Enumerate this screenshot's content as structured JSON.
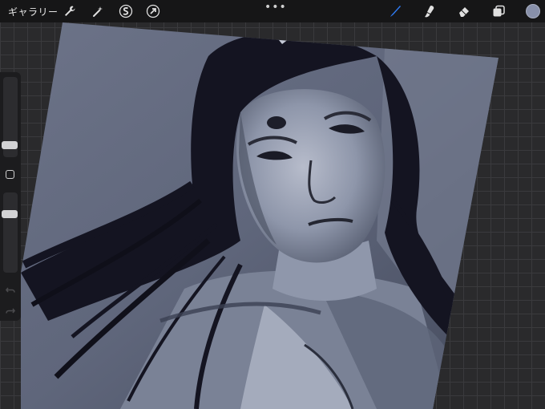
{
  "toolbar": {
    "gallery_label": "ギャラリー",
    "left_tools": [
      "wrench-icon",
      "magic-wand-icon",
      "selection-s-icon",
      "transform-arrow-icon"
    ],
    "more_label": "•••",
    "right_tools": [
      "brush-icon",
      "smudge-icon",
      "eraser-icon",
      "layers-icon"
    ],
    "current_color": "#8890aa",
    "brush_accent": "#2f7cf6"
  },
  "sidebar": {
    "brush_size_level": 0.3,
    "opacity_level": 0.27,
    "modifier_label": "modifier-square",
    "undo_icon": "undo-icon",
    "redo_icon": "redo-icon"
  },
  "canvas": {
    "palette": [
      "#5d6477",
      "#8b93a8",
      "#141421",
      "#b7bccb",
      "#3e4354"
    ]
  }
}
